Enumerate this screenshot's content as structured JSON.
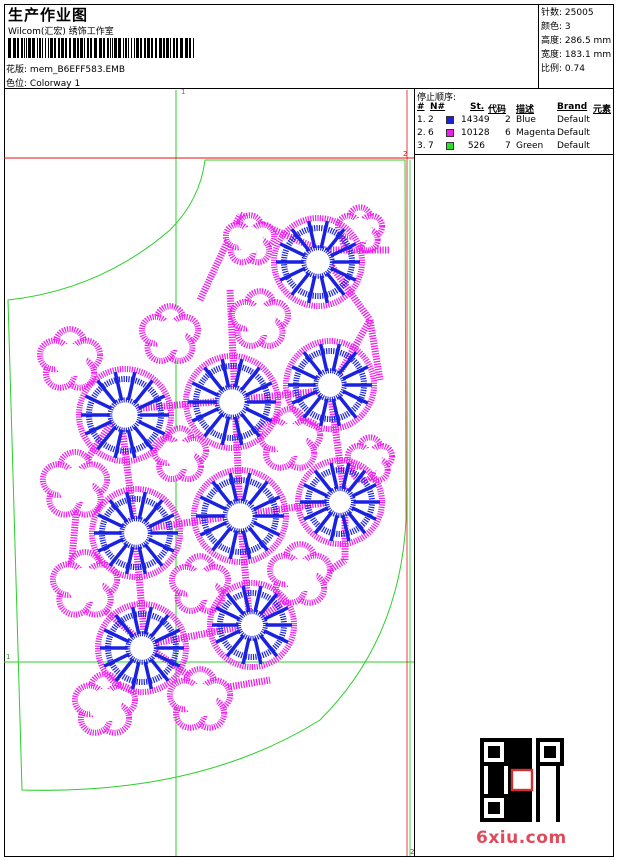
{
  "header": {
    "title": "生产作业图",
    "company": "Wilcom(汇宏) 绣饰工作室",
    "file_label": "花版:",
    "file_name": "mem_B6EFF583.EMB",
    "colorway_label": "色位:",
    "colorway_name": "Colorway 1"
  },
  "stats": {
    "stitches_label": "针数:",
    "stitches": "25005",
    "colors_label": "颜色:",
    "colors": "3",
    "height_label": "高度:",
    "height": "286.5 mm",
    "width_label": "宽度:",
    "width": "183.1 mm",
    "scale_label": "比例:",
    "scale": "0.74"
  },
  "stop_sequence": {
    "title": "停止顺序:",
    "headers": {
      "num": "#",
      "needle": "N#",
      "stitches": "St.",
      "code": "代码",
      "desc": "描述",
      "brand": "Brand",
      "element": "元素"
    },
    "rows": [
      {
        "num": "1.",
        "needle": "2",
        "color": "#1a22e0",
        "stitches": "14349",
        "code": "2",
        "desc": "Blue",
        "brand": "Default"
      },
      {
        "num": "2.",
        "needle": "6",
        "color": "#f01cf0",
        "stitches": "10128",
        "code": "6",
        "desc": "Magenta",
        "brand": "Default"
      },
      {
        "num": "3.",
        "needle": "7",
        "color": "#28e028",
        "stitches": "526",
        "code": "7",
        "desc": "Green",
        "brand": "Default"
      }
    ]
  },
  "guides": {
    "top_marker": "1",
    "right_marker_top": "2",
    "left_marker": "1",
    "bottom_marker": "2"
  },
  "colors": {
    "blue": "#1a22e0",
    "magenta": "#f01cf0",
    "green": "#28d028",
    "guide_red": "#e01010"
  },
  "watermark": "6xiu.com",
  "qr_icon": "qr-code-icon"
}
